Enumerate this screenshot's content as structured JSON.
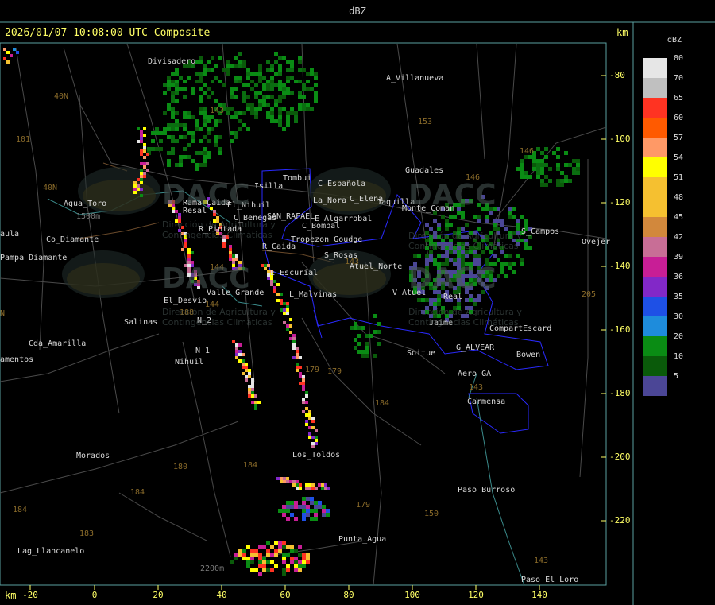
{
  "window": {
    "title": "dBZ"
  },
  "map": {
    "caption": "2026/01/07 10:08:00 UTC Composite",
    "x_unit": "km",
    "y_unit": "km",
    "x_ticks": [
      "-20",
      "0",
      "20",
      "40",
      "60",
      "80",
      "100",
      "120",
      "140"
    ],
    "y_ticks": [
      "-80",
      "-100",
      "-120",
      "-140",
      "-160",
      "-180",
      "-200",
      "-220"
    ],
    "places": [
      "Divisadero",
      "A_Villanueva",
      "Guadales",
      "Monte_Coman",
      "Jaquilla",
      "Tombui",
      "Isilla",
      "C_Española",
      "La_Nora",
      "C_Elena",
      "Resal",
      "El_Nihuil",
      "Rama_Caida",
      "C_Benegas",
      "SAN_RAFAEL",
      "E_Algarrobal",
      "C_Bombal",
      "R_Pintada",
      "Tropezon Goudge",
      "R_Caida",
      "S_Rosas",
      "Atuel_Norte",
      "E_Escurial",
      "Valle_Grande",
      "L_Malvinas",
      "V_Atuel",
      "Real",
      "Jaime",
      "El_Desvio",
      "N_2",
      "Salinas",
      "N_1",
      "Nihuil",
      "Cda_Amarilla",
      "amentos",
      "Agua_Toro",
      "Co_Diamante",
      "Pampa_Diamante",
      "aula",
      "Soitue",
      "G_ALVEAR",
      "Bowen",
      "CompartEscard",
      "Aero_GA",
      "Carmensa",
      "S_Campos",
      "Ovejer",
      "Los_Toldos",
      "Morados",
      "Paso_Burroso",
      "Punta_Agua",
      "Lag_Llancanelo",
      "Paso_El_Loro"
    ],
    "route_numbers": [
      "40N",
      "40N",
      "101",
      "143",
      "153",
      "146",
      "146",
      "143",
      "144",
      "144",
      "188",
      "180",
      "184",
      "184",
      "184",
      "179",
      "179",
      "184",
      "179",
      "150",
      "143",
      "143",
      "183",
      "205",
      "N"
    ],
    "elevation_labels": [
      "1500m",
      "2200m"
    ],
    "watermarks": [
      "DACC",
      "DACC",
      "DACC",
      "DACC",
      "Dirección de Agricultura y Contingencias Climáticas",
      "Dirección de Agricultura y Contingencias Climáticas",
      "Dirección de Agricultura y Contingencias Climáticas",
      "Dirección de Agricultura y Contingencias Climáticas"
    ]
  },
  "legend": {
    "title": "dBZ",
    "scale": [
      {
        "label": "80",
        "color": "#e6e6e6"
      },
      {
        "label": "70",
        "color": "#c0c0c0"
      },
      {
        "label": "65",
        "color": "#ff3322"
      },
      {
        "label": "60",
        "color": "#ff5a00"
      },
      {
        "label": "57",
        "color": "#ff9966"
      },
      {
        "label": "54",
        "color": "#ffff00"
      },
      {
        "label": "51",
        "color": "#f5c030"
      },
      {
        "label": "48",
        "color": "#f5c030"
      },
      {
        "label": "45",
        "color": "#d2883c"
      },
      {
        "label": "42",
        "color": "#c86e96"
      },
      {
        "label": "39",
        "color": "#c81e96"
      },
      {
        "label": "36",
        "color": "#8228c8"
      },
      {
        "label": "35",
        "color": "#1e50e6"
      },
      {
        "label": "30",
        "color": "#1e8cdc"
      },
      {
        "label": "20",
        "color": "#0a8c14"
      },
      {
        "label": "10",
        "color": "#0a5a0a"
      },
      {
        "label": "5",
        "color": "#4b4696"
      }
    ]
  }
}
